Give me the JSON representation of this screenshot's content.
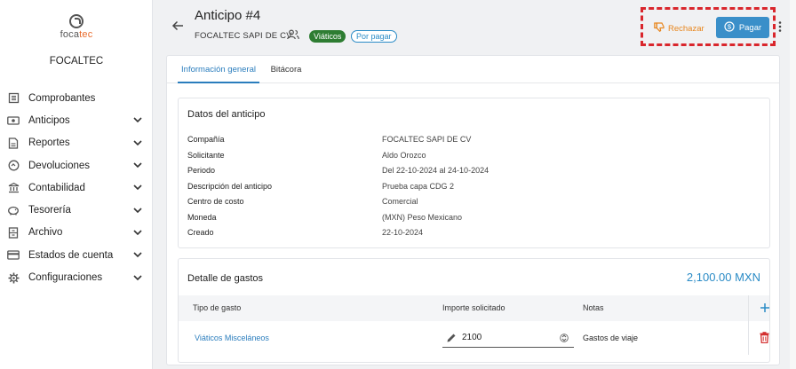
{
  "sidebar": {
    "logo": {
      "part1": "foca",
      "part2": "tec"
    },
    "company": "FOCALTEC",
    "items": [
      {
        "label": "Comprobantes",
        "icon": "receipt-icon",
        "has_chevron": false
      },
      {
        "label": "Anticipos",
        "icon": "money-icon",
        "has_chevron": true
      },
      {
        "label": "Reportes",
        "icon": "report-icon",
        "has_chevron": true
      },
      {
        "label": "Devoluciones",
        "icon": "refund-icon",
        "has_chevron": true
      },
      {
        "label": "Contabilidad",
        "icon": "bank-icon",
        "has_chevron": true
      },
      {
        "label": "Tesorería",
        "icon": "piggy-bank-icon",
        "has_chevron": true
      },
      {
        "label": "Archivo",
        "icon": "archive-icon",
        "has_chevron": true
      },
      {
        "label": "Estados de cuenta",
        "icon": "card-icon",
        "has_chevron": true
      },
      {
        "label": "Configuraciones",
        "icon": "gear-icon",
        "has_chevron": true
      }
    ]
  },
  "header": {
    "title": "Anticipo #4",
    "company": "FOCALTEC SAPI DE CV",
    "badge_type": "Viáticos",
    "badge_status": "Por pagar",
    "reject_label": "Rechazar",
    "pay_label": "Pagar"
  },
  "tabs": [
    {
      "label": "Información general",
      "active": true
    },
    {
      "label": "Bitácora",
      "active": false
    }
  ],
  "details": {
    "title": "Datos del anticipo",
    "fields": [
      {
        "label": "Compañía",
        "value": "FOCALTEC SAPI DE CV"
      },
      {
        "label": "Solicitante",
        "value": "Aldo Orozco"
      },
      {
        "label": "Periodo",
        "value": "Del 22-10-2024 al 24-10-2024"
      },
      {
        "label": "Descripción del anticipo",
        "value": "Prueba capa CDG 2"
      },
      {
        "label": "Centro de costo",
        "value": "Comercial"
      },
      {
        "label": "Moneda",
        "value": "(MXN) Peso Mexicano"
      },
      {
        "label": "Creado",
        "value": "22-10-2024"
      }
    ]
  },
  "expenses": {
    "title": "Detalle de gastos",
    "total": "2,100.00 MXN",
    "columns": {
      "type": "Tipo de gasto",
      "amount": "Importe solicitado",
      "notes": "Notas"
    },
    "rows": [
      {
        "type": "Viáticos Misceláneos",
        "amount": "2100",
        "notes": "Gastos de viaje"
      }
    ]
  },
  "colors": {
    "accent": "#2a7dbd",
    "pay_button": "#3a8fc9",
    "reject": "#e8861d",
    "badge_green": "#2e7d32",
    "delete": "#d32f2f",
    "highlight": "#d9262c"
  }
}
